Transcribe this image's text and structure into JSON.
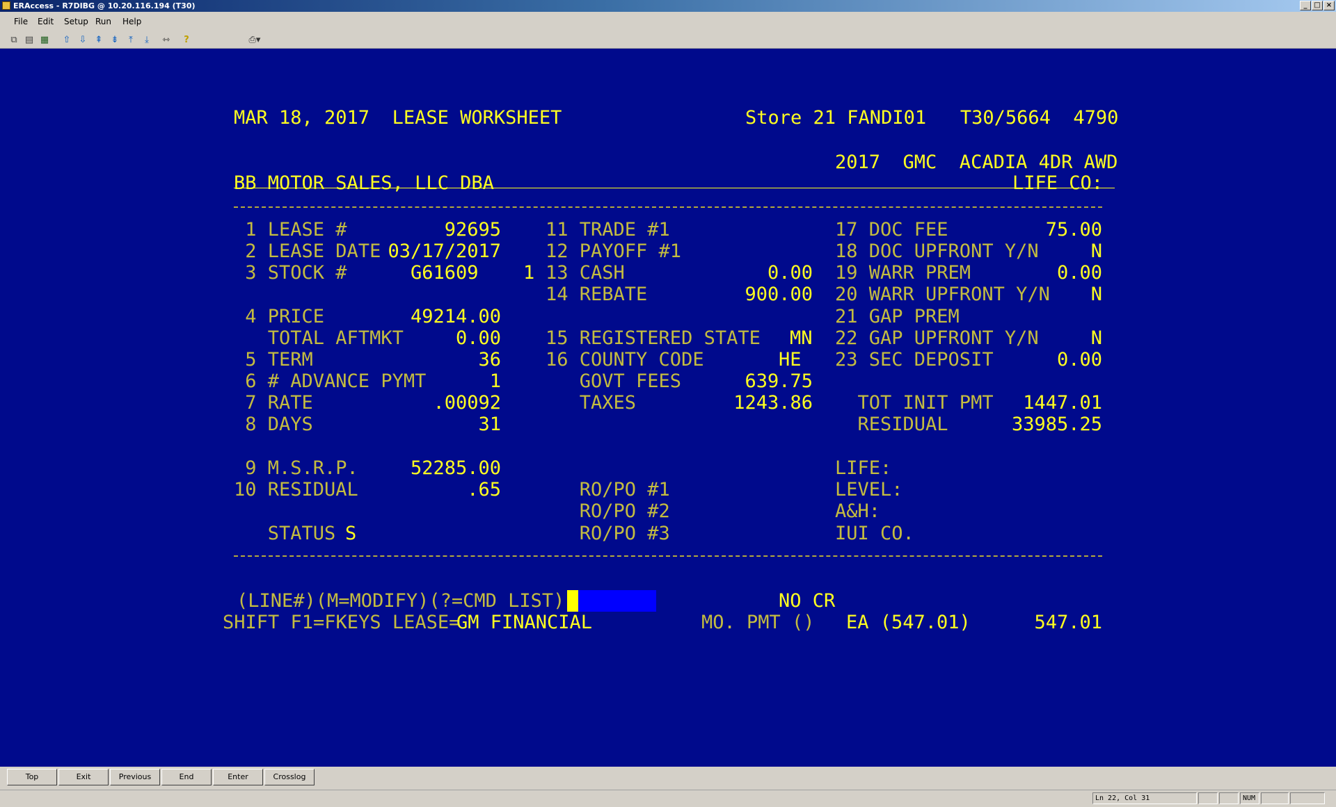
{
  "window": {
    "title": "ERAccess - R7DIBG @ 10.20.116.194 (T30)",
    "min": "_",
    "max": "□",
    "close": "×"
  },
  "menu": [
    "File",
    "Edit",
    "Setup",
    "Run",
    "Help"
  ],
  "screen": {
    "header_left": "MAR 18, 2017  LEASE WORKSHEET",
    "header_right": "Store 21 FANDI01   T30/5664  4790",
    "vehicle": "2017  GMC  ACADIA 4DR AWD",
    "dealer": "BB MOTOR SALES, LLC DBA",
    "life_co": "LIFE CO:",
    "col1": [
      {
        "label": " 1 LEASE #",
        "value": "92695"
      },
      {
        "label": " 2 LEASE DATE",
        "value": "03/17/2017"
      },
      {
        "label": " 3 STOCK #",
        "value": "G61609"
      },
      {
        "label": " 4 PRICE",
        "value": "49214.00"
      },
      {
        "label": "   TOTAL AFTMKT",
        "value": "0.00"
      },
      {
        "label": " 5 TERM",
        "value": "36"
      },
      {
        "label": " 6 # ADVANCE PYMT",
        "value": "1"
      },
      {
        "label": " 7 RATE",
        "value": ".00092"
      },
      {
        "label": " 8 DAYS",
        "value": "31"
      },
      {
        "label": " 9 M.S.R.P.",
        "value": "52285.00"
      },
      {
        "label": "10 RESIDUAL",
        "value": ".65"
      },
      {
        "label": "   STATUS",
        "value": "S"
      }
    ],
    "stock_extra": "1",
    "col2": [
      {
        "label": "11 TRADE #1",
        "value": ""
      },
      {
        "label": "12 PAYOFF #1",
        "value": ""
      },
      {
        "label": "13 CASH",
        "value": "0.00"
      },
      {
        "label": "14 REBATE",
        "value": "900.00"
      },
      {
        "label": "15 REGISTERED STATE",
        "value": "MN"
      },
      {
        "label": "16 COUNTY CODE",
        "value": "HE"
      },
      {
        "label": "   GOVT FEES",
        "value": "639.75"
      },
      {
        "label": "   TAXES",
        "value": "1243.86"
      },
      {
        "label": "   RO/PO #1",
        "value": ""
      },
      {
        "label": "   RO/PO #2",
        "value": ""
      },
      {
        "label": "   RO/PO #3",
        "value": ""
      }
    ],
    "col3": [
      {
        "label": "17 DOC FEE",
        "value": "75.00"
      },
      {
        "label": "18 DOC UPFRONT Y/N",
        "value": "N"
      },
      {
        "label": "19 WARR PREM",
        "value": "0.00"
      },
      {
        "label": "20 WARR UPFRONT Y/N",
        "value": "N"
      },
      {
        "label": "21 GAP PREM",
        "value": ""
      },
      {
        "label": "22 GAP UPFRONT Y/N",
        "value": "N"
      },
      {
        "label": "23 SEC DEPOSIT",
        "value": "0.00"
      },
      {
        "label": "  TOT INIT PMT",
        "value": "1447.01"
      },
      {
        "label": "  RESIDUAL",
        "value": "33985.25"
      },
      {
        "label": "LIFE:",
        "value": ""
      },
      {
        "label": "LEVEL:",
        "value": ""
      },
      {
        "label": "A&H:",
        "value": ""
      },
      {
        "label": "IUI CO.",
        "value": ""
      }
    ],
    "prompt": "(LINE#)(M=MODIFY)(?=CMD LIST)",
    "no_cr": "NO CR",
    "footer_keys": "SHIFT F1=FKEYS LEASE=",
    "lender": "GM FINANCIAL",
    "mo_pmt_label": "MO. PMT ()",
    "mo_pmt_ea": "EA (547.01)",
    "mo_pmt_value": "547.01"
  },
  "fkeys": [
    "Top",
    "Exit",
    "Previous",
    "End",
    "Enter",
    "Crosslog"
  ],
  "status": {
    "position": "Ln 22, Col 31",
    "num": "NUM"
  }
}
